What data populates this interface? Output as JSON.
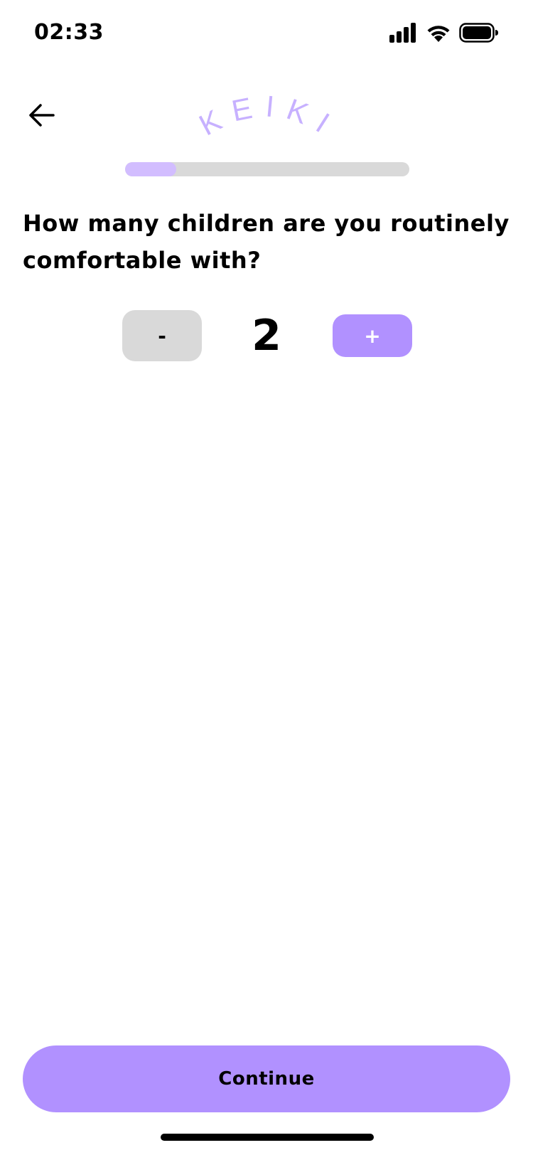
{
  "status_bar": {
    "time": "02:33",
    "icons": [
      "cellular-signal-icon",
      "wifi-icon",
      "battery-icon"
    ]
  },
  "header": {
    "back_icon": "arrow-left-icon",
    "logo_text": "KEIKI",
    "logo_color": "#c7b1ff"
  },
  "progress": {
    "value": 0.18,
    "track_color": "#d9d9d9",
    "fill_color": "#d2bdff"
  },
  "question": {
    "text": "How many children are you routinely comfortable with?"
  },
  "stepper": {
    "decrement_label": "-",
    "value": "2",
    "increment_label": "+",
    "decrement_color": "#d9d9d9",
    "increment_color": "#b191ff"
  },
  "footer": {
    "continue_label": "Continue",
    "accent_color": "#b191ff"
  }
}
